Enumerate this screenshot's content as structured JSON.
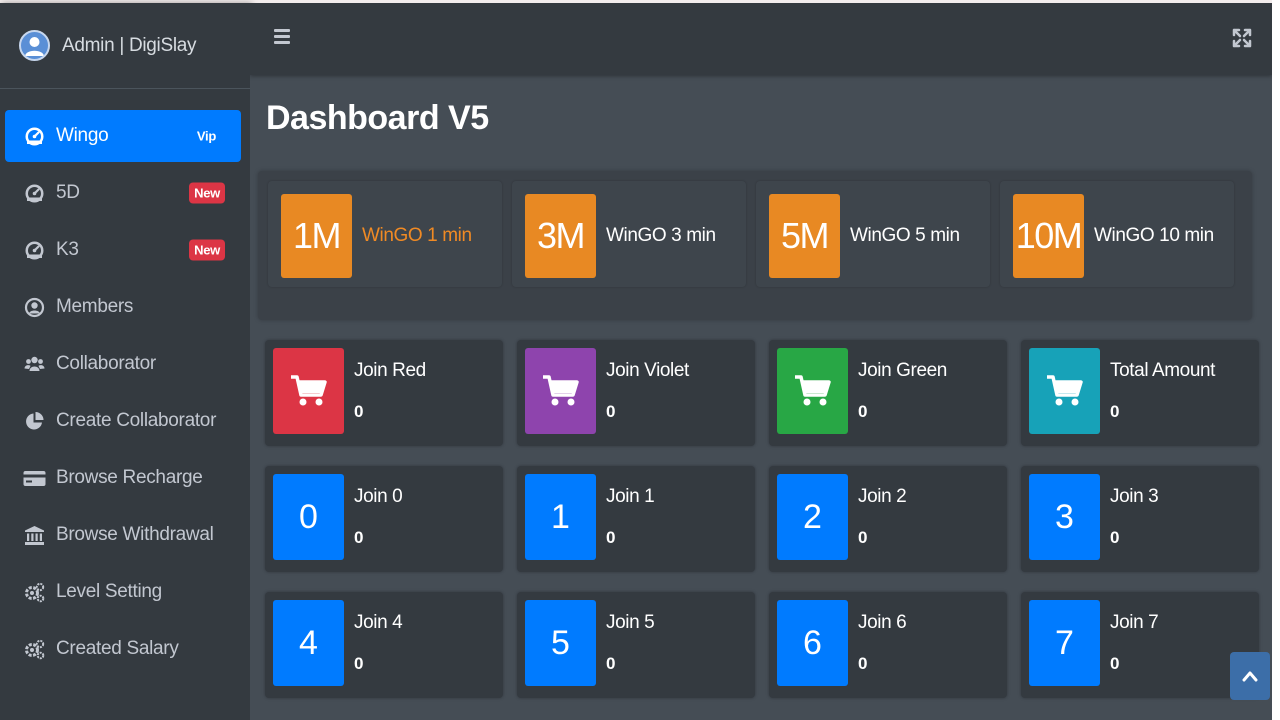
{
  "brand": {
    "text": "Admin | DigiSlay"
  },
  "sidebar": {
    "items": [
      {
        "label": "Wingo",
        "badge": "Vip",
        "icon": "tachometer-icon"
      },
      {
        "label": "5D",
        "badge": "New",
        "icon": "tachometer-icon"
      },
      {
        "label": "K3",
        "badge": "New",
        "icon": "tachometer-icon"
      },
      {
        "label": "Members",
        "icon": "user-circle-icon"
      },
      {
        "label": "Collaborator",
        "icon": "users-icon"
      },
      {
        "label": "Create Collaborator",
        "icon": "pie-chart-icon"
      },
      {
        "label": "Browse Recharge",
        "icon": "credit-card-icon"
      },
      {
        "label": "Browse Withdrawal",
        "icon": "bank-icon"
      },
      {
        "label": "Level Setting",
        "icon": "cogs-icon"
      },
      {
        "label": "Created Salary",
        "icon": "cogs-icon"
      }
    ]
  },
  "header": {
    "title": "Dashboard V5"
  },
  "games": [
    {
      "code": "1M",
      "label": "WinGO 1 min"
    },
    {
      "code": "3M",
      "label": "WinGO 3 min"
    },
    {
      "code": "5M",
      "label": "WinGO 5 min"
    },
    {
      "code": "10M",
      "label": "WinGO 10 min"
    }
  ],
  "colors": {
    "red": "#dc3545",
    "violet": "#8e44ad",
    "green": "#28a745",
    "teal": "#17a2b8",
    "blue": "#007bff",
    "orange": "#e88923"
  },
  "stats": [
    {
      "label": "Join Red",
      "value": "0",
      "icon": "cart-icon"
    },
    {
      "label": "Join Violet",
      "value": "0",
      "icon": "cart-icon"
    },
    {
      "label": "Join Green",
      "value": "0",
      "icon": "cart-icon"
    },
    {
      "label": "Total Amount",
      "value": "0",
      "icon": "cart-icon"
    }
  ],
  "numbers": [
    {
      "digit": "0",
      "label": "Join 0",
      "value": "0"
    },
    {
      "digit": "1",
      "label": "Join 1",
      "value": "0"
    },
    {
      "digit": "2",
      "label": "Join 2",
      "value": "0"
    },
    {
      "digit": "3",
      "label": "Join 3",
      "value": "0"
    },
    {
      "digit": "4",
      "label": "Join 4",
      "value": "0"
    },
    {
      "digit": "5",
      "label": "Join 5",
      "value": "0"
    },
    {
      "digit": "6",
      "label": "Join 6",
      "value": "0"
    },
    {
      "digit": "7",
      "label": "Join 7",
      "value": "0"
    }
  ]
}
